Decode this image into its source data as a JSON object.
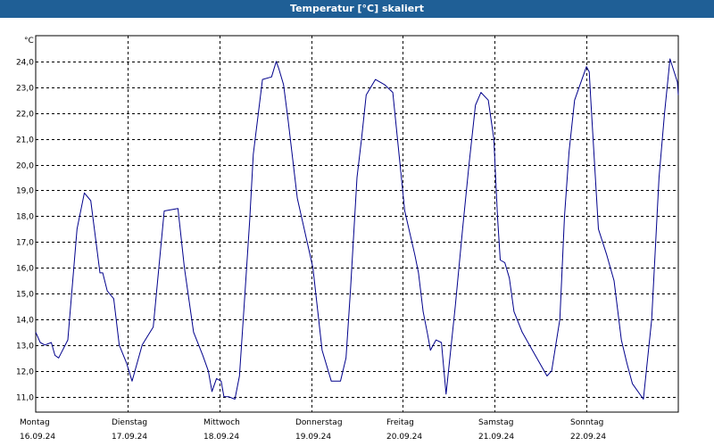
{
  "window": {
    "title": "Temperatur [°C] skaliert"
  },
  "colors": {
    "titlebar": "#1f5f96",
    "series": "#00008b",
    "grid": "#000000"
  },
  "chart_data": {
    "type": "line",
    "title": "Temperatur [°C] skaliert",
    "ylabel": "°C",
    "ylim": [
      10.4,
      25
    ],
    "yticks": [
      11.0,
      12.0,
      13.0,
      14.0,
      15.0,
      16.0,
      17.0,
      18.0,
      19.0,
      20.0,
      21.0,
      22.0,
      23.0,
      24.0
    ],
    "ytick_labels": [
      "11,0",
      "12,0",
      "13,0",
      "14,0",
      "15,0",
      "16,0",
      "17,0",
      "18,0",
      "19,0",
      "20,0",
      "21,0",
      "22,0",
      "23,0",
      "24,0"
    ],
    "xlim": [
      0,
      7
    ],
    "days": [
      {
        "weekday": "Montag",
        "date": "16.09.24"
      },
      {
        "weekday": "Dienstag",
        "date": "17.09.24"
      },
      {
        "weekday": "Mittwoch",
        "date": "18.09.24"
      },
      {
        "weekday": "Donnerstag",
        "date": "19.09.24"
      },
      {
        "weekday": "Freitag",
        "date": "20.09.24"
      },
      {
        "weekday": "Samstag",
        "date": "21.09.24"
      },
      {
        "weekday": "Sonntag",
        "date": "22.09.24"
      }
    ],
    "grid": true,
    "series": [
      {
        "x": [
          0,
          0.05,
          0.1,
          0.17,
          0.21,
          0.25,
          0.35,
          0.45,
          0.53,
          0.6,
          0.7,
          0.73,
          0.78,
          0.85,
          0.91,
          0.99,
          1.05,
          1.16,
          1.21,
          1.28,
          1.4,
          1.55,
          1.62,
          1.72,
          1.82,
          1.88,
          1.92,
          1.97,
          2.02,
          2.05,
          2.1,
          2.17,
          2.22,
          2.27,
          2.33,
          2.37,
          2.47,
          2.57,
          2.62,
          2.65,
          2.7,
          2.75,
          2.85,
          3.02,
          3.12,
          3.22,
          3.32,
          3.38,
          3.43,
          3.5,
          3.55,
          3.6,
          3.7,
          3.8,
          3.89,
          4.02,
          4.13,
          4.17,
          4.22,
          4.27,
          4.3,
          4.36,
          4.42,
          4.47,
          4.57,
          4.65,
          4.72,
          4.79,
          4.85,
          4.93,
          4.99,
          5.03,
          5.06,
          5.11,
          5.16,
          5.21,
          5.3,
          5.41,
          5.57,
          5.62,
          5.71,
          5.76,
          5.81,
          5.87,
          5.95,
          6.0,
          6.03,
          6.05,
          6.13,
          6.22,
          6.3,
          6.38,
          6.44,
          6.5,
          6.62,
          6.71,
          6.79,
          6.85,
          6.91,
          6.99,
          7.0
        ],
        "y": [
          13.5,
          13.1,
          13.0,
          13.1,
          12.6,
          12.5,
          13.2,
          17.5,
          18.9,
          18.6,
          15.8,
          15.8,
          15.1,
          14.8,
          13.0,
          12.3,
          11.6,
          13.0,
          13.3,
          13.7,
          18.2,
          18.3,
          16.0,
          13.5,
          12.6,
          12.0,
          11.2,
          11.7,
          11.6,
          11.0,
          11.0,
          10.9,
          11.8,
          14.5,
          17.8,
          20.4,
          23.3,
          23.4,
          24.0,
          23.7,
          23.1,
          21.7,
          18.7,
          16.0,
          12.8,
          11.6,
          11.6,
          12.5,
          15.2,
          19.5,
          21.0,
          22.7,
          23.3,
          23.1,
          22.8,
          18.2,
          16.5,
          15.8,
          14.3,
          13.4,
          12.8,
          13.2,
          13.1,
          11.1,
          14.5,
          17.5,
          20.0,
          22.3,
          22.8,
          22.5,
          21.0,
          18.0,
          16.3,
          16.2,
          15.6,
          14.3,
          13.5,
          12.8,
          11.8,
          12.0,
          14.0,
          18.0,
          20.5,
          22.5,
          23.3,
          23.8,
          23.6,
          22.3,
          17.5,
          16.5,
          15.5,
          13.2,
          12.3,
          11.5,
          10.9,
          14.0,
          19.5,
          22.0,
          24.1,
          23.2,
          22.7
        ]
      }
    ]
  }
}
